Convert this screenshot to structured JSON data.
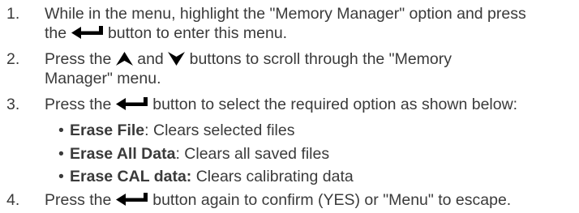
{
  "steps": [
    {
      "number": "1.",
      "line1_before": "While in the menu, highlight the \"Memory Manager\" option and press",
      "line2_before": "the",
      "line2_after": "button to enter this menu."
    },
    {
      "number": "2.",
      "line1_before": "Press the",
      "line1_mid": "and",
      "line1_after": "buttons to scroll through the \"Memory",
      "line2": "Manager\" menu."
    },
    {
      "number": "3.",
      "line1_before": "Press the",
      "line1_after": "button to select the required option as shown below:",
      "bullets": [
        {
          "label": "Erase File",
          "sep": ":",
          "desc": " Clears selected files"
        },
        {
          "label": "Erase All Data",
          "sep": ":",
          "desc": " Clears all saved files"
        },
        {
          "label": "Erase CAL data:",
          "sep": "",
          "desc": " Clears calibrating data"
        }
      ]
    },
    {
      "number": "4.",
      "line1_before": "Press the",
      "line1_after": "button again to confirm (YES) or \"Menu\" to escape."
    }
  ],
  "bullet_char": "•",
  "icons": {
    "enter": "enter-arrow-icon",
    "up": "up-arrow-icon",
    "down": "down-arrow-icon"
  },
  "colors": {
    "text": "#3a3a3a",
    "icon": "#000000"
  }
}
